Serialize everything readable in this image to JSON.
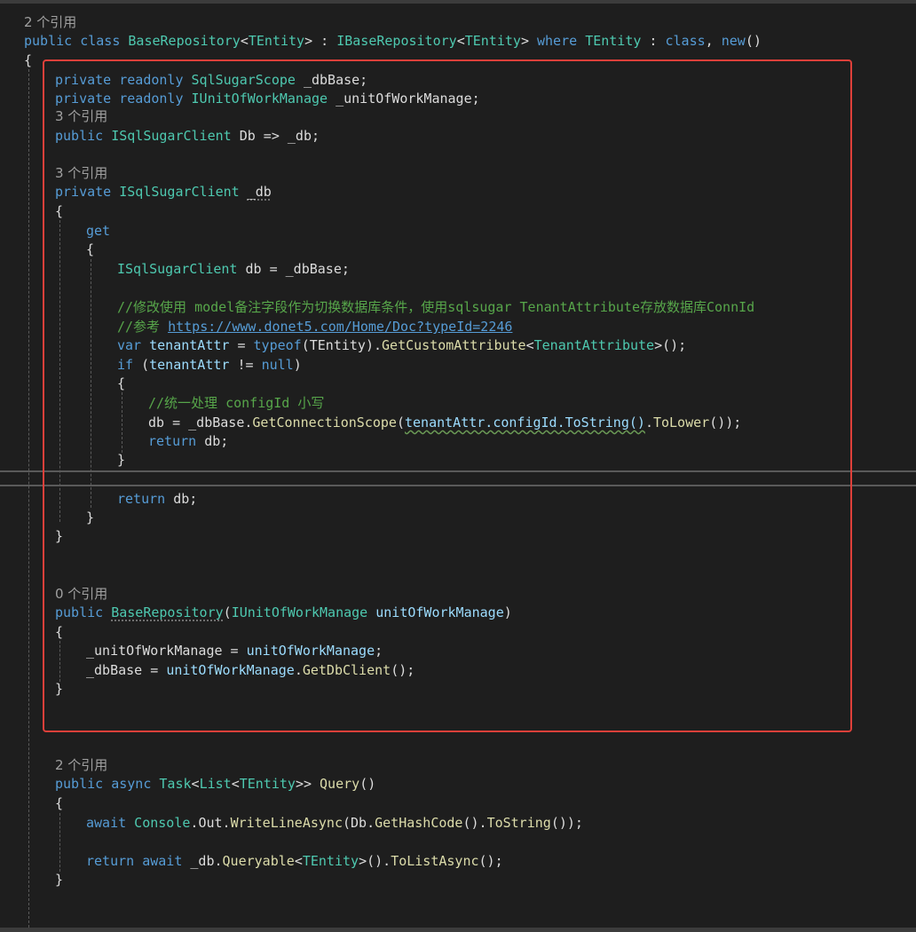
{
  "refs": {
    "class": "2 个引用",
    "db": "3 个引用",
    "_db": "3 个引用",
    "ctor": "0 个引用",
    "query": "2 个引用"
  },
  "code": {
    "class_decl": {
      "kw_public": "public",
      "kw_class": "class",
      "name": "BaseRepository",
      "lt": "<",
      "tentity": "TEntity",
      "gt": ">",
      "colon": " : ",
      "iface": "IBaseRepository",
      "where": "where",
      "constraint": " : ",
      "kw_class2": "class",
      "comma": ", ",
      "new": "new",
      "parens": "()"
    },
    "open_brace": "{",
    "close_brace": "}",
    "field1": {
      "mod": "private readonly",
      "type": "SqlSugarScope",
      "name": " _dbBase;"
    },
    "field2": {
      "mod": "private readonly",
      "type": "IUnitOfWorkManage",
      "name": " _unitOfWorkManage;"
    },
    "prop_db": {
      "mod": "public",
      "type": "ISqlSugarClient",
      "rest": " Db => _db;"
    },
    "prop__db": {
      "mod": "private",
      "type": "ISqlSugarClient",
      "name": "_db"
    },
    "get": "get",
    "local_decl": {
      "type": "ISqlSugarClient",
      "rest": " db = _dbBase;"
    },
    "comment1": "//修改使用 model备注字段作为切换数据库条件，使用sqlsugar TenantAttribute存放数据库ConnId",
    "comment2_prefix": "//参考 ",
    "comment2_link": "https://www.donet5.com/Home/Doc?typeId=2246",
    "var_line": {
      "var": "var",
      "name": " tenantAttr",
      "eq": " = ",
      "typeof": "typeof",
      "arg": "(TEntity).",
      "method": "GetCustomAttribute",
      "lt": "<",
      "attr": "TenantAttribute",
      "end": ">();"
    },
    "if_line": {
      "if": "if",
      "open": " (",
      "name": "tenantAttr",
      "op": " != ",
      "null": "null",
      "close": ")"
    },
    "comment3": "//统一处理 configId 小写",
    "assign_line": {
      "start": "db = _dbBase.",
      "method": "GetConnectionScope",
      "open": "(",
      "squiggle": "tenantAttr.configId.ToString()",
      "dot": ".",
      "method2": "ToLower",
      "end": "());"
    },
    "return_kw": "return",
    "return_db": " db;",
    "ctor": {
      "mod": "public",
      "name": "BaseRepository",
      "open": "(",
      "ptype": "IUnitOfWorkManage",
      "pname": " unitOfWorkManage",
      "close": ")"
    },
    "ctor_line1": {
      "left": "_unitOfWorkManage = ",
      "right": "unitOfWorkManage",
      "end": ";"
    },
    "ctor_line2": {
      "left": "_dbBase = ",
      "right": "unitOfWorkManage",
      "dot": ".",
      "method": "GetDbClient",
      "end": "();"
    },
    "query_decl": {
      "mod": "public",
      "async": " async ",
      "task": "Task",
      "lt": "<",
      "list": "List",
      "lt2": "<",
      "tentity": "TEntity",
      "gt": ">>",
      "name": " Query",
      "parens": "()"
    },
    "await_line": {
      "await": "await",
      "console": " Console",
      "dot": ".",
      "out": "Out",
      "dot2": ".",
      "method": "WriteLineAsync",
      "mid": "(Db.",
      "hash": "GetHashCode",
      "mid2": "().",
      "tostr": "ToString",
      "end": "());"
    },
    "return_line2": {
      "return": "return",
      "await": " await",
      "mid": " _db.",
      "method": "Queryable",
      "lt": "<",
      "tentity": "TEntity",
      "mid2": ">().",
      "method2": "ToListAsync",
      "end": "();"
    }
  },
  "colors": {
    "background": "#1e1e1e",
    "keyword": "#569cd6",
    "type": "#4ec9b0",
    "method": "#dcdcaa",
    "parameter": "#9cdcfe",
    "comment": "#57a64a",
    "highlight_box": "#e0403a"
  }
}
